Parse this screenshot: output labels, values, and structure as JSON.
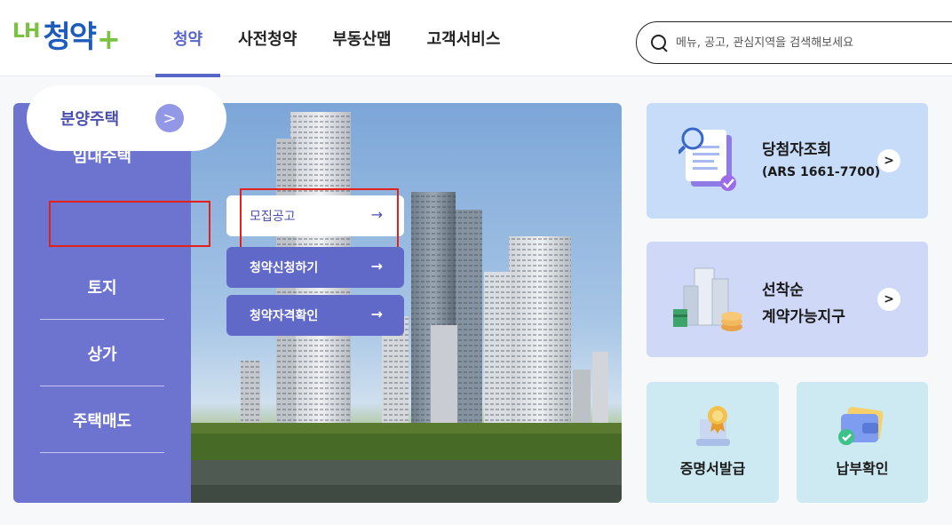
{
  "header": {
    "logo_lh": "LH",
    "logo_main": "청약",
    "logo_plus": "+",
    "nav": [
      "청약",
      "사전청약",
      "부동산맵",
      "고객서비스"
    ],
    "search_placeholder": "메뉴, 공고, 관심지역을 검색해보세요"
  },
  "sidebar": {
    "items": [
      "임대주택",
      "분양주택",
      "토지",
      "상가",
      "주택매도"
    ],
    "active_index": 1,
    "active_arrow": ">"
  },
  "submenu": {
    "items": [
      {
        "label": "모집공고",
        "arrow": "→"
      },
      {
        "label": "청약신청하기",
        "arrow": "→"
      },
      {
        "label": "청약자격확인",
        "arrow": "→"
      }
    ]
  },
  "cards": {
    "winner": {
      "title": "당첨자조회",
      "sub": "(ARS 1661-7700)",
      "icon": "document-search-icon"
    },
    "firstcome": {
      "title_line1": "선착순",
      "title_line2": "계약가능지구",
      "icon": "buildings-coins-icon"
    },
    "certificate": {
      "label": "증명서발급",
      "icon": "certificate-icon"
    },
    "payment": {
      "label": "납부확인",
      "icon": "wallet-check-icon"
    },
    "chevron": ">"
  },
  "colors": {
    "accent": "#5865c9",
    "sidebar": "#6d74cf",
    "highlight_box": "#e3211c"
  }
}
